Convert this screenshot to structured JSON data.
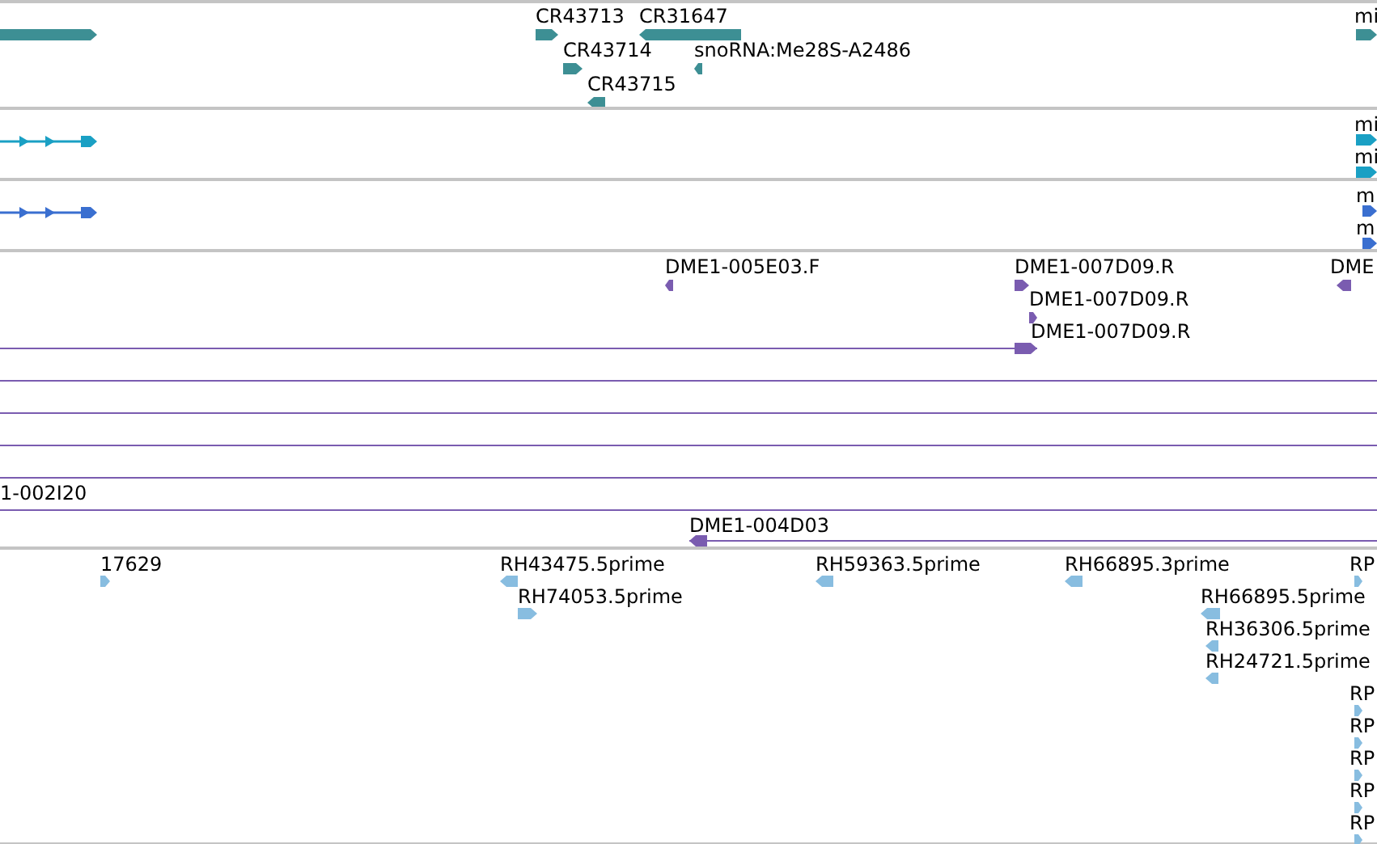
{
  "tracks": [
    {
      "color": "#3d8f94",
      "features": [
        {
          "kind": "block",
          "reverse": false
        },
        {
          "kind": "block",
          "reverse": false,
          "label": "CR43713"
        },
        {
          "kind": "block",
          "reverse": true,
          "label": "CR31647"
        },
        {
          "kind": "block",
          "reverse": false,
          "label": "CR43714"
        },
        {
          "kind": "block",
          "reverse": true,
          "label": "snoRNA:Me28S-A2486"
        },
        {
          "kind": "block",
          "reverse": true,
          "label": "CR43715"
        },
        {
          "kind": "block",
          "reverse": false,
          "label": "mi"
        }
      ]
    },
    {
      "color": "#1aa0c4",
      "features": [
        {
          "kind": "model",
          "reverse": false
        },
        {
          "kind": "block",
          "reverse": false,
          "label": "mi"
        },
        {
          "kind": "block",
          "reverse": false,
          "label": "mi"
        }
      ]
    },
    {
      "color": "#3a6fd0",
      "features": [
        {
          "kind": "model",
          "reverse": false
        },
        {
          "kind": "block",
          "reverse": false,
          "label": "m"
        },
        {
          "kind": "block",
          "reverse": false,
          "label": "m"
        }
      ]
    },
    {
      "color": "#7a5cb0",
      "features": [
        {
          "kind": "block",
          "reverse": true,
          "label": "DME1-005E03.F"
        },
        {
          "kind": "block",
          "reverse": false,
          "label": "DME1-007D09.R"
        },
        {
          "kind": "block",
          "reverse": false,
          "label": "DME1-007D09.R"
        },
        {
          "kind": "block",
          "reverse": false,
          "label": "DME1-007D09.R"
        },
        {
          "kind": "block",
          "reverse": true,
          "label": "DME"
        },
        {
          "kind": "span"
        },
        {
          "kind": "span"
        },
        {
          "kind": "span"
        },
        {
          "kind": "span"
        },
        {
          "kind": "span",
          "label": "1-002I20"
        },
        {
          "kind": "block",
          "reverse": true,
          "label": "DME1-004D03"
        }
      ]
    },
    {
      "color": "#88bde0",
      "features": [
        {
          "kind": "block",
          "reverse": false,
          "label": "17629"
        },
        {
          "kind": "block",
          "reverse": true,
          "label": "RH43475.5prime"
        },
        {
          "kind": "block",
          "reverse": false,
          "label": "RH74053.5prime"
        },
        {
          "kind": "block",
          "reverse": true,
          "label": "RH59363.5prime"
        },
        {
          "kind": "block",
          "reverse": true,
          "label": "RH66895.3prime"
        },
        {
          "kind": "block",
          "reverse": false,
          "label": "RP"
        },
        {
          "kind": "block",
          "reverse": true,
          "label": "RH66895.5prime"
        },
        {
          "kind": "block",
          "reverse": true,
          "label": "RH36306.5prime"
        },
        {
          "kind": "block",
          "reverse": true,
          "label": "RH24721.5prime"
        },
        {
          "kind": "block",
          "reverse": false,
          "label": "RP"
        },
        {
          "kind": "block",
          "reverse": false,
          "label": "RP"
        },
        {
          "kind": "block",
          "reverse": false,
          "label": "RP"
        },
        {
          "kind": "block",
          "reverse": false,
          "label": "RP"
        },
        {
          "kind": "block",
          "reverse": false,
          "label": "RP"
        }
      ]
    }
  ]
}
